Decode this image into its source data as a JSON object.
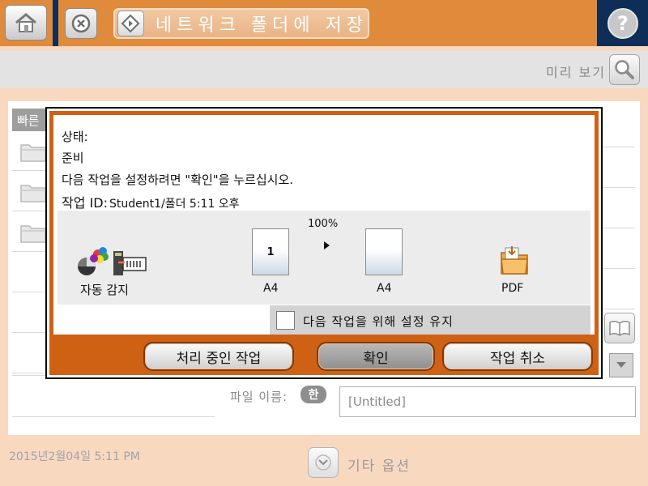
{
  "header": {
    "title": "네트워크 폴더에 저장",
    "home_icon": "home-icon",
    "cancel_icon": "cancel-icon",
    "start_icon": "start-icon",
    "help_label": "?"
  },
  "preview": {
    "label": "미리 보기",
    "icon": "magnifier-icon"
  },
  "quick_sets": {
    "tab_label": "빠른",
    "folder_icon": "folder-icon"
  },
  "file_name": {
    "label": "파일 이름:",
    "keyboard_label": "한",
    "value": "[Untitled]"
  },
  "footer": {
    "timestamp": "2015년2월04일 5:11 PM",
    "more_options": "기타 옵션",
    "more_icon": "chevron-down-icon"
  },
  "dialog": {
    "status_label": "상태:",
    "status_value": "준비",
    "instruction": "다음 작업을 설정하려면 \"확인\"을 누르십시오.",
    "job_id_label": "작업 ID:",
    "job_id_value": "Student1/폴더 5:11 오후",
    "input_label": "자동 감지",
    "scale": "100%",
    "source_page_num": "1",
    "source_size": "A4",
    "output_size": "A4",
    "output_format": "PDF",
    "retain_settings": {
      "label": "다음 작업을 위해 설정 유지",
      "checked": false
    },
    "buttons": {
      "active_jobs": "처리 중인 작업",
      "ok": "확인",
      "cancel_job": "작업 취소"
    }
  },
  "colors": {
    "header_orange": "#e08a3c",
    "header_navy": "#0f2e57",
    "dialog_orange": "#cf6114",
    "background": "#f8d9c0"
  }
}
